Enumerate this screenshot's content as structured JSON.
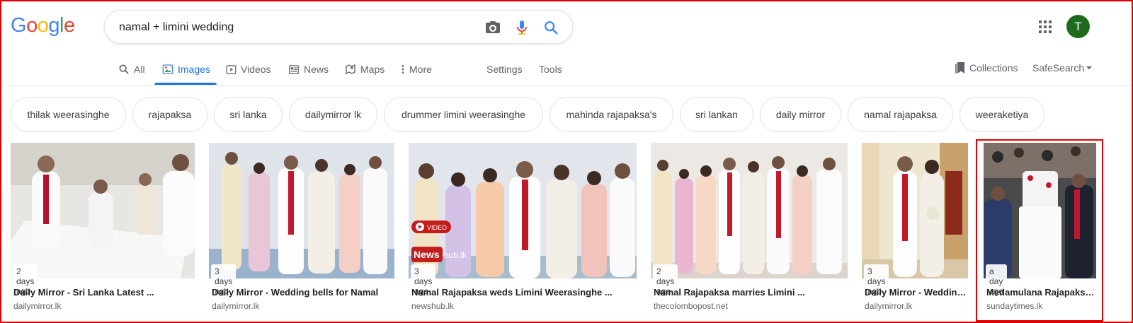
{
  "header": {
    "logo_letters": [
      {
        "ch": "G",
        "color": "#4285F4"
      },
      {
        "ch": "o",
        "color": "#EA4335"
      },
      {
        "ch": "o",
        "color": "#FBBC05"
      },
      {
        "ch": "g",
        "color": "#4285F4"
      },
      {
        "ch": "l",
        "color": "#34A853"
      },
      {
        "ch": "e",
        "color": "#EA4335"
      }
    ],
    "search_query": "namal + limini wedding",
    "avatar_initial": "T"
  },
  "nav": {
    "tabs": [
      {
        "label": "All",
        "icon": "search-icon"
      },
      {
        "label": "Images",
        "icon": "image-icon",
        "active": true
      },
      {
        "label": "Videos",
        "icon": "play-icon"
      },
      {
        "label": "News",
        "icon": "newspaper-icon"
      },
      {
        "label": "Maps",
        "icon": "map-icon"
      },
      {
        "label": "More",
        "icon": "more-vert-icon"
      }
    ],
    "settings": "Settings",
    "tools": "Tools",
    "collections": "Collections",
    "safesearch": "SafeSearch"
  },
  "chips": [
    "thilak weerasinghe",
    "rajapaksa",
    "sri lanka",
    "dailymirror lk",
    "drummer limini weerasinghe",
    "mahinda rajapaksa's",
    "sri lankan",
    "daily mirror",
    "namal rajapaksa",
    "weeraketiya"
  ],
  "results": [
    {
      "badge": "2 days ago",
      "title": "Daily Mirror - Sri Lanka Latest ...",
      "source": "dailymirror.lk",
      "selected": false
    },
    {
      "badge": "3 days ago",
      "title": "Daily Mirror - Wedding bells for Namal",
      "source": "dailymirror.lk",
      "selected": false
    },
    {
      "badge": "3 days ago",
      "title": "Namal Rajapaksa weds Limini Weerasinghe ...",
      "source": "newshub.lk",
      "selected": false
    },
    {
      "badge": "2 days ago",
      "title": "Namal Rajapaksa marries Limini ...",
      "source": "thecolombopost.net",
      "selected": false
    },
    {
      "badge": "3 days ago",
      "title": "Daily Mirror - Wedding...",
      "source": "dailymirror.lk",
      "selected": false
    },
    {
      "badge": "a day ago",
      "title": "Medamulana Rajapaksa ...",
      "source": "sundaytimes.lk",
      "selected": true
    }
  ],
  "colors": {
    "accent": "#1a73e8",
    "selection": "#e00000",
    "avatar": "#1e6b1e"
  }
}
